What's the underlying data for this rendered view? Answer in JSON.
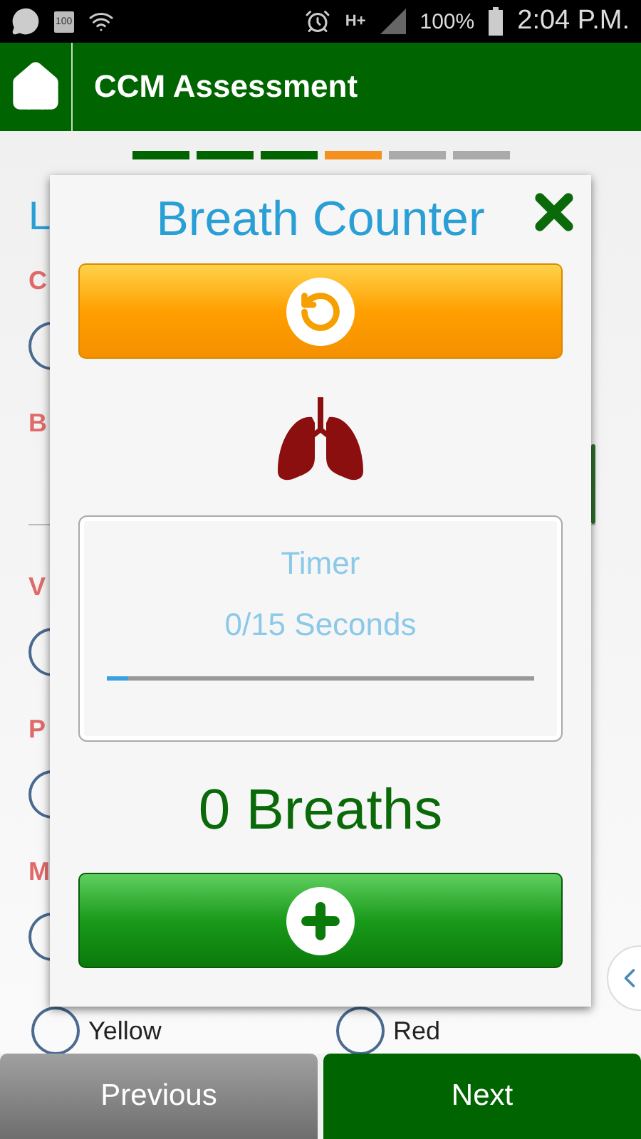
{
  "status_bar": {
    "battery_badge": "100",
    "network": "H+",
    "battery": "100%",
    "time": "2:04 P.M."
  },
  "app_bar": {
    "title": "CCM Assessment"
  },
  "steps": [
    {
      "kind": "done"
    },
    {
      "kind": "done"
    },
    {
      "kind": "done"
    },
    {
      "kind": "current"
    },
    {
      "kind": "todo"
    },
    {
      "kind": "todo"
    }
  ],
  "form_behind": [
    {
      "kind": "heading",
      "text": "L"
    },
    {
      "kind": "label",
      "text": "C"
    },
    {
      "kind": "radio",
      "selected": false
    },
    {
      "kind": "label",
      "text": "B"
    },
    {
      "kind": "field"
    },
    {
      "kind": "label",
      "text": "V"
    },
    {
      "kind": "radio",
      "selected": false
    },
    {
      "kind": "label",
      "text": "P"
    },
    {
      "kind": "radio",
      "selected": false
    },
    {
      "kind": "label",
      "text": "M"
    },
    {
      "kind": "radio",
      "selected": false
    }
  ],
  "color_options": [
    {
      "label": "Yellow",
      "selected": false
    },
    {
      "label": "Red",
      "selected": false
    }
  ],
  "dialog": {
    "title": "Breath Counter",
    "timer": {
      "label": "Timer",
      "reading": "0/15 Seconds",
      "level": 0.05
    },
    "count": "0 Breaths"
  },
  "footer": {
    "previous": "Previous",
    "next": "Next"
  }
}
